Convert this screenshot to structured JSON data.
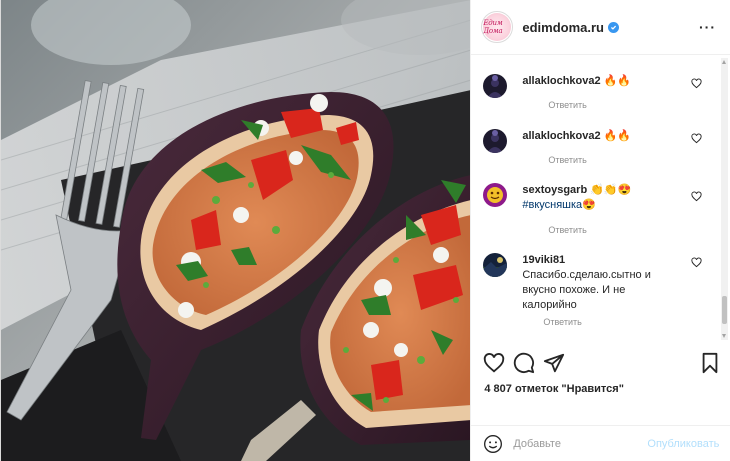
{
  "post": {
    "username": "edimdoma.ru",
    "verified": true,
    "avatar_logo_text": "Едим Дома",
    "more_icon": "more-dots-icon"
  },
  "photo": {
    "icon": "photo-image",
    "subject": "stuffed eggplant with bulgur, tomatoes, herbs and sauce on slate with fork"
  },
  "comments": [
    {
      "username": "allaklochkova2",
      "text": "🔥🔥",
      "reply": "Ответить",
      "avatar": "dark-silhouette"
    },
    {
      "username": "allaklochkova2",
      "text": "🔥🔥",
      "reply": "Ответить",
      "avatar": "dark-silhouette"
    },
    {
      "username": "sextoysgarb",
      "text": "👏👏😍",
      "hashtag": "#вкусняшка😍",
      "reply": "Ответить",
      "avatar": "pink-emoji-logo"
    },
    {
      "username": "19viki81",
      "text": "Спасибо.сделаю.сытно и вкусно похоже. И не калорийно",
      "reply": "Ответить",
      "avatar": "dark-landscape"
    }
  ],
  "actions": {
    "like_icon": "heart-outline-icon",
    "comment_icon": "comment-bubble-icon",
    "share_icon": "paper-plane-icon",
    "save_icon": "bookmark-outline-icon"
  },
  "likes_text": "4 807 отметок \"Нравится\"",
  "composer": {
    "placeholder": "Добавьте",
    "publish_label": "Опубликовать",
    "emoji_icon": "smiley-icon"
  },
  "colors": {
    "link_blue": "#00376b",
    "verified_blue": "#3897f0",
    "publish_disabled": "#b2dffc"
  }
}
